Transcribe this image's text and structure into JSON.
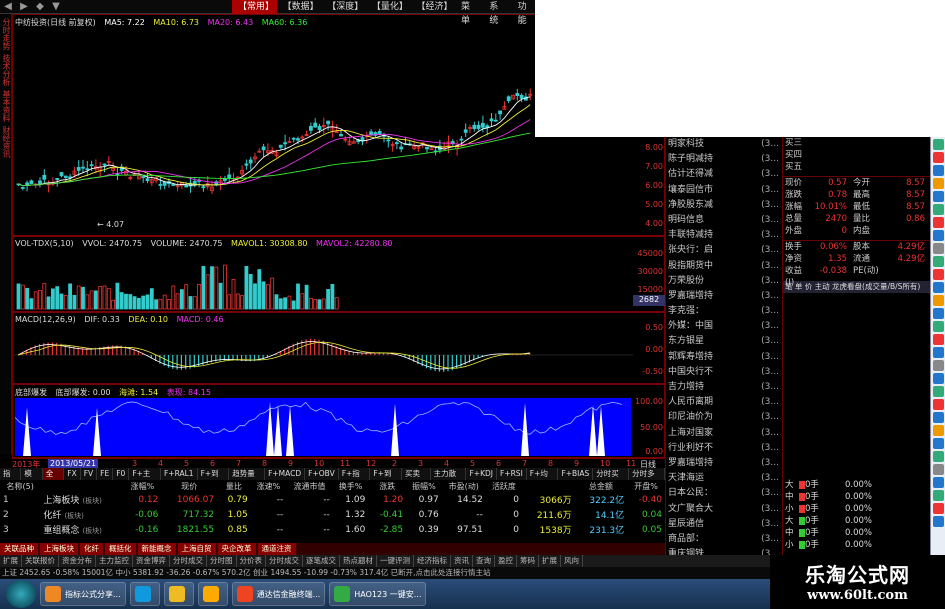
{
  "menu": {
    "nav": [
      "◀",
      "▶",
      "◆",
      "▼"
    ],
    "items": [
      "【常用】",
      "【数据】",
      "【深度】",
      "【量化】",
      "【经济】",
      "菜单",
      "系统",
      "功能"
    ]
  },
  "leftstrip": [
    "分时走势",
    "技术分析",
    "基本资料",
    "财经资讯"
  ],
  "main": {
    "title": "中纺投资(日线 前复权)",
    "ma5": "MA5: 7.22",
    "ma10": "MA10: 6.73",
    "ma20": "MA20: 6.43",
    "ma60": "MA60: 6.36",
    "low_mark": "← 4.07"
  },
  "vol": {
    "title": "VOL-TDX(5,10)",
    "vvol": "VVOL: 2470.75",
    "volume": "VOLUME: 2470.75",
    "mavol1": "MAVOL1: 30308.80",
    "mavol2": "MAVOL2: 42280.80",
    "ticks": [
      "45000",
      "30000",
      "15000"
    ],
    "tag": "2682"
  },
  "macd": {
    "title": "MACD(12,26,9)",
    "dif": "DIF: 0.33",
    "dea": "DEA: 0.10",
    "macd": "MACD: 0.46",
    "ticks": [
      "0.50",
      "0.00",
      "-0.50"
    ]
  },
  "ind": {
    "title": "底部爆发",
    "v1": "底部爆发: 0.00",
    "v2": "海滩: 1.54",
    "v3": "表现: 84.15",
    "ticks": [
      "100.00",
      "50.00",
      "0.00"
    ]
  },
  "price_ticks": [
    "8.00",
    "7.00",
    "6.00",
    "5.00",
    "4.00"
  ],
  "xaxis": {
    "label": "2013年",
    "date": "2013/05/21",
    "months": [
      "3",
      "4",
      "5",
      "6",
      "7",
      "8",
      "9",
      "10",
      "11",
      "12",
      "2",
      "3",
      "4",
      "5",
      "6",
      "7",
      "8",
      "9",
      "10",
      "11"
    ],
    "right": "日线"
  },
  "rightlist": [
    [
      "明家科技",
      "(3..."
    ],
    [
      "陈子明减持",
      "(3..."
    ],
    [
      "估计还得减",
      "(3..."
    ],
    [
      "壤泰园信市",
      "(3..."
    ],
    [
      "净胶股东减",
      "(3..."
    ],
    [
      "明码信息",
      "(3..."
    ],
    [
      "丰联特减持",
      "(3..."
    ],
    [
      "张央行：启",
      "(3..."
    ],
    [
      "股指期货中",
      "(3..."
    ],
    [
      "万荣股份",
      "(3..."
    ],
    [
      "罗嘉瑞增持",
      "(3..."
    ],
    [
      "李克强：",
      "(3..."
    ],
    [
      "外媒：中国",
      "(3..."
    ],
    [
      "东方银星",
      "(3..."
    ],
    [
      "郭辉寿增持",
      "(3..."
    ],
    [
      "中国央行不",
      "(3..."
    ],
    [
      "吉力增持",
      "(3..."
    ],
    [
      "人民币离期",
      "(3..."
    ],
    [
      "印尼油价为",
      "(3..."
    ],
    [
      "上海对国家",
      "(3..."
    ],
    [
      "行业利好不",
      "(3..."
    ],
    [
      "罗嘉瑞增持",
      "(3..."
    ],
    [
      "天津海运",
      "(3..."
    ],
    [
      "日本公民：",
      "(3..."
    ],
    [
      "文广聚合大",
      "(3..."
    ],
    [
      "星辰通信",
      "(3..."
    ],
    [
      "商品部：",
      "(3..."
    ],
    [
      "重庆钢铁",
      "(3..."
    ]
  ],
  "quote": {
    "top": [
      "买三",
      "买四",
      "买五"
    ],
    "rows": [
      [
        "现价",
        "0.57",
        "今开",
        "8.57"
      ],
      [
        "涨跌",
        "0.78",
        "最高",
        "8.57"
      ],
      [
        "涨幅",
        "10.01%",
        "最低",
        "8.57"
      ],
      [
        "总量",
        "2470",
        "量比",
        "0.86"
      ],
      [
        "外盘",
        "0",
        "内盘",
        ""
      ]
    ],
    "rows2": [
      [
        "换手",
        "0.06%",
        "股本",
        "4.29亿"
      ],
      [
        "净资",
        "1.35",
        "流通",
        "4.29亿"
      ],
      [
        "收益(Ⅰ)",
        "-0.038",
        "PE(动)",
        ""
      ]
    ],
    "tabs": "笔  单  价  主动  龙虎看盘(成交量/B/S所有)",
    "bottom": [
      [
        "大",
        "0手",
        "0.00%"
      ],
      [
        "中",
        "0手",
        "0.00%"
      ],
      [
        "小",
        "0手",
        "0.00%"
      ],
      [
        "大",
        "0手",
        "0.00%"
      ],
      [
        "中",
        "0手",
        "0.00%"
      ],
      [
        "小",
        "0手",
        "0.00%"
      ]
    ]
  },
  "tabs": [
    "指标",
    "模板",
    "全部",
    "FX",
    "FV",
    "FE",
    "F0",
    "F+主图",
    "F+RAL1",
    "F+到量",
    "趋势量线",
    "F+MACD",
    "F+OBV",
    "F+指数",
    "F+到图",
    "买卖点",
    "主力散户",
    "F+KDJ",
    "F+RSI",
    "F+均线",
    "F+BIAS",
    "分时买卖",
    "分时多空"
  ],
  "board": {
    "headers": [
      "名称(5)",
      "",
      "涨幅%",
      "现价",
      "量比",
      "涨速%",
      "流通市值",
      "换手%",
      "涨跌",
      "振幅%",
      "市盈(动)",
      "活跃度",
      "",
      "总金额",
      "开盘%"
    ],
    "rows": [
      {
        "n": "1",
        "name": "上海板块",
        "tag": "(板块)",
        "chg": "0.12",
        "price": "1066.07",
        "ratio": "0.79",
        "speed": "--",
        "mv": "--",
        "turn": "1.09",
        "diff": "1.20",
        "amp": "0.97",
        "pe": "14.52",
        "act": "0",
        "vol": "3066万",
        "amt": "322.2亿",
        "open": "-0.40",
        "c": "#e33"
      },
      {
        "n": "2",
        "name": "化纤",
        "tag": "(板块)",
        "chg": "-0.06",
        "price": "717.32",
        "ratio": "1.05",
        "speed": "--",
        "mv": "--",
        "turn": "1.32",
        "diff": "-0.41",
        "amp": "0.76",
        "pe": "--",
        "act": "0",
        "vol": "211.6万",
        "amt": "14.1亿",
        "open": "0.04",
        "c": "#3c3"
      },
      {
        "n": "3",
        "name": "重组概念",
        "tag": "(板块)",
        "chg": "-0.16",
        "price": "1821.55",
        "ratio": "0.85",
        "speed": "--",
        "mv": "--",
        "turn": "1.60",
        "diff": "-2.85",
        "amp": "0.39",
        "pe": "97.51",
        "act": "0",
        "vol": "1538万",
        "amt": "231.3亿",
        "open": "0.05",
        "c": "#3c3"
      }
    ]
  },
  "sectabs": [
    "关联品种",
    "上海板块",
    "化纤",
    "概括化",
    "新能概念",
    "上海自贸",
    "央企改革",
    "通道注资"
  ],
  "funcbar": [
    "扩展",
    "关联报价",
    "资金分布",
    "主力监控",
    "资金博弈",
    "分时成交",
    "分时图",
    "分价表",
    "分时成交",
    "逐笔成交",
    "热点题材",
    "一键评测",
    "经济指标",
    "资讯",
    "查询",
    "盈控",
    "筹码",
    "扩展",
    "风向"
  ],
  "status": "上证 2452.65  -0.58%  15001亿  中小 5381.92  -36.26  -0.67%  570.2亿  创业 1494.55  -10.99  -0.73%  317.4亿     已断开,点击此处连接行情主站",
  "taskbar": [
    "指标公式分享...",
    "",
    "",
    "通达信金融终端...",
    "HAO123 一键安..."
  ],
  "brand": {
    "line1": "乐淘公式网",
    "line2": "www.60lt.com"
  },
  "colors": {
    "up": "#e33",
    "down": "#3c3",
    "accent": "#800",
    "blue": "#00f"
  }
}
